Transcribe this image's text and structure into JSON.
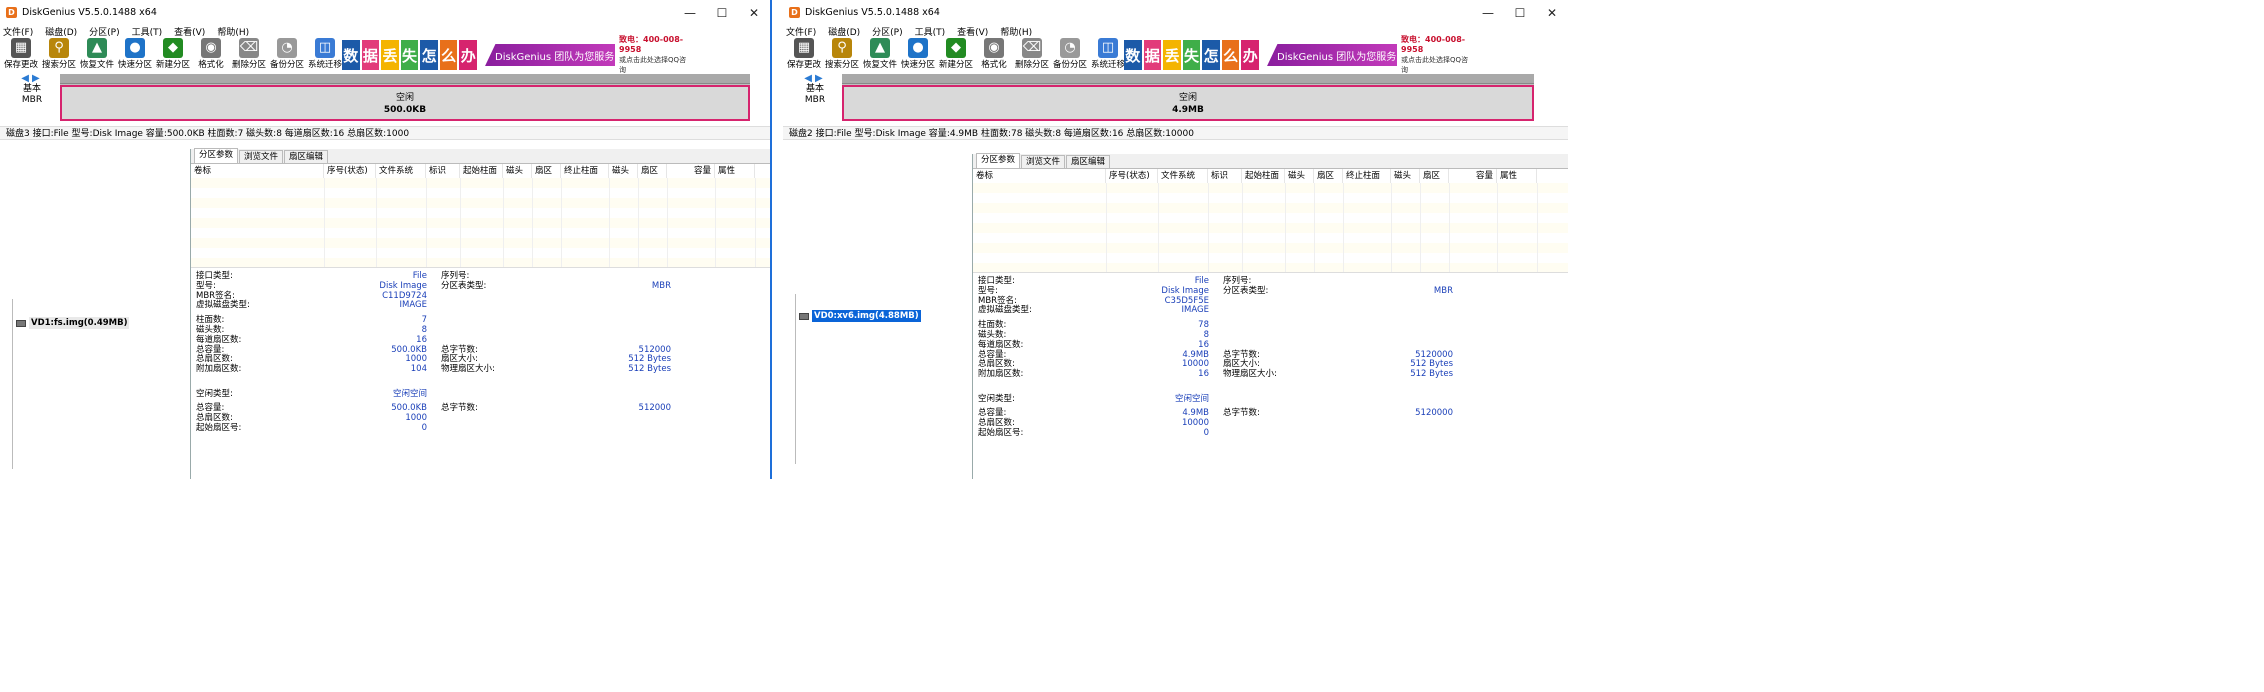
{
  "window_left": {
    "title": "DiskGenius V5.5.0.1488 x64",
    "disk_type": "基本",
    "disk_scheme": "MBR",
    "partition_label": "空闲",
    "partition_size": "500.0KB",
    "status_line": "磁盘3 接口:File  型号:Disk Image  容量:500.0KB  柱面数:7  磁头数:8  每道扇区数:16  总扇区数:1000",
    "tree_item": "VD1:fs.img(0.49MB)",
    "info": {
      "interface_type": "File",
      "model": "Disk Image",
      "mbr_signature": "C11D9724",
      "virtual_disk_type": "IMAGE",
      "serial": "",
      "partition_table_type": "MBR",
      "cylinders": "7",
      "heads": "8",
      "sectors_per_track": "16",
      "total_capacity": "500.0KB",
      "total_sectors": "1000",
      "additional_sectors": "104",
      "total_bytes": "512000",
      "sector_size": "512 Bytes",
      "physical_sector_size": "512 Bytes",
      "free_type": "空闲空间",
      "free_capacity": "500.0KB",
      "free_sectors": "1000",
      "free_start_sector": "0",
      "free_total_bytes": "512000"
    }
  },
  "window_right": {
    "title": "DiskGenius V5.5.0.1488 x64",
    "disk_type": "基本",
    "disk_scheme": "MBR",
    "partition_label": "空闲",
    "partition_size": "4.9MB",
    "status_line": "磁盘2 接口:File  型号:Disk Image  容量:4.9MB  柱面数:78  磁头数:8  每道扇区数:16  总扇区数:10000",
    "tree_item": "VD0:xv6.img(4.88MB)",
    "info": {
      "interface_type": "File",
      "model": "Disk Image",
      "mbr_signature": "C35D5F5E",
      "virtual_disk_type": "IMAGE",
      "serial": "",
      "partition_table_type": "MBR",
      "cylinders": "78",
      "heads": "8",
      "sectors_per_track": "16",
      "total_capacity": "4.9MB",
      "total_sectors": "10000",
      "additional_sectors": "16",
      "total_bytes": "5120000",
      "sector_size": "512 Bytes",
      "physical_sector_size": "512 Bytes",
      "free_type": "空闲空间",
      "free_capacity": "4.9MB",
      "free_sectors": "10000",
      "free_start_sector": "0",
      "free_total_bytes": "5120000"
    }
  },
  "menu": [
    "文件(F)",
    "磁盘(D)",
    "分区(P)",
    "工具(T)",
    "查看(V)",
    "帮助(H)"
  ],
  "toolbar": [
    {
      "label": "保存更改",
      "icon": "save-icon",
      "color": "#555555"
    },
    {
      "label": "搜索分区",
      "icon": "search-icon",
      "color": "#b8860b"
    },
    {
      "label": "恢复文件",
      "icon": "recover-icon",
      "color": "#2e8b57"
    },
    {
      "label": "快速分区",
      "icon": "quick-partition-icon",
      "color": "#1e73c8"
    },
    {
      "label": "新建分区",
      "icon": "new-partition-icon",
      "color": "#228b22"
    },
    {
      "label": "格式化",
      "icon": "format-icon",
      "color": "#777777"
    },
    {
      "label": "删除分区",
      "icon": "delete-icon",
      "color": "#888888"
    },
    {
      "label": "备份分区",
      "icon": "backup-icon",
      "color": "#999999"
    },
    {
      "label": "系统迁移",
      "icon": "migrate-icon",
      "color": "#3a7bd5"
    }
  ],
  "banner": {
    "chars": [
      "数",
      "据",
      "丢",
      "失",
      "怎",
      "么",
      "办"
    ],
    "char_colors": [
      "#1c5aa8",
      "#e23b7a",
      "#f4b400",
      "#3fae49",
      "#1c5aa8",
      "#e8701a",
      "#d6246e"
    ],
    "slogan": "DiskGenius 团队为您服务",
    "phone": "致电：400-008-9958",
    "qq": "或点击此处选择QQ咨询"
  },
  "tabs": [
    "分区参数",
    "浏览文件",
    "扇区编辑"
  ],
  "columns": [
    "卷标",
    "序号(状态)",
    "文件系统",
    "标识",
    "起始柱面",
    "磁头",
    "扇区",
    "终止柱面",
    "磁头",
    "扇区",
    "容量",
    "属性"
  ],
  "labels": {
    "interface_type": "接口类型:",
    "model": "型号:",
    "mbr_signature": "MBR签名:",
    "virtual_disk_type": "虚拟磁盘类型:",
    "serial": "序列号:",
    "partition_table_type": "分区表类型:",
    "cylinders": "柱面数:",
    "heads": "磁头数:",
    "sectors_per_track": "每道扇区数:",
    "total_capacity": "总容量:",
    "total_sectors": "总扇区数:",
    "additional_sectors": "附加扇区数:",
    "total_bytes": "总字节数:",
    "sector_size": "扇区大小:",
    "physical_sector_size": "物理扇区大小:",
    "free_type": "空闲类型:",
    "free_capacity": "总容量:",
    "free_sectors": "总扇区数:",
    "free_start_sector": "起始扇区号:",
    "free_total_bytes": "总字节数:"
  }
}
